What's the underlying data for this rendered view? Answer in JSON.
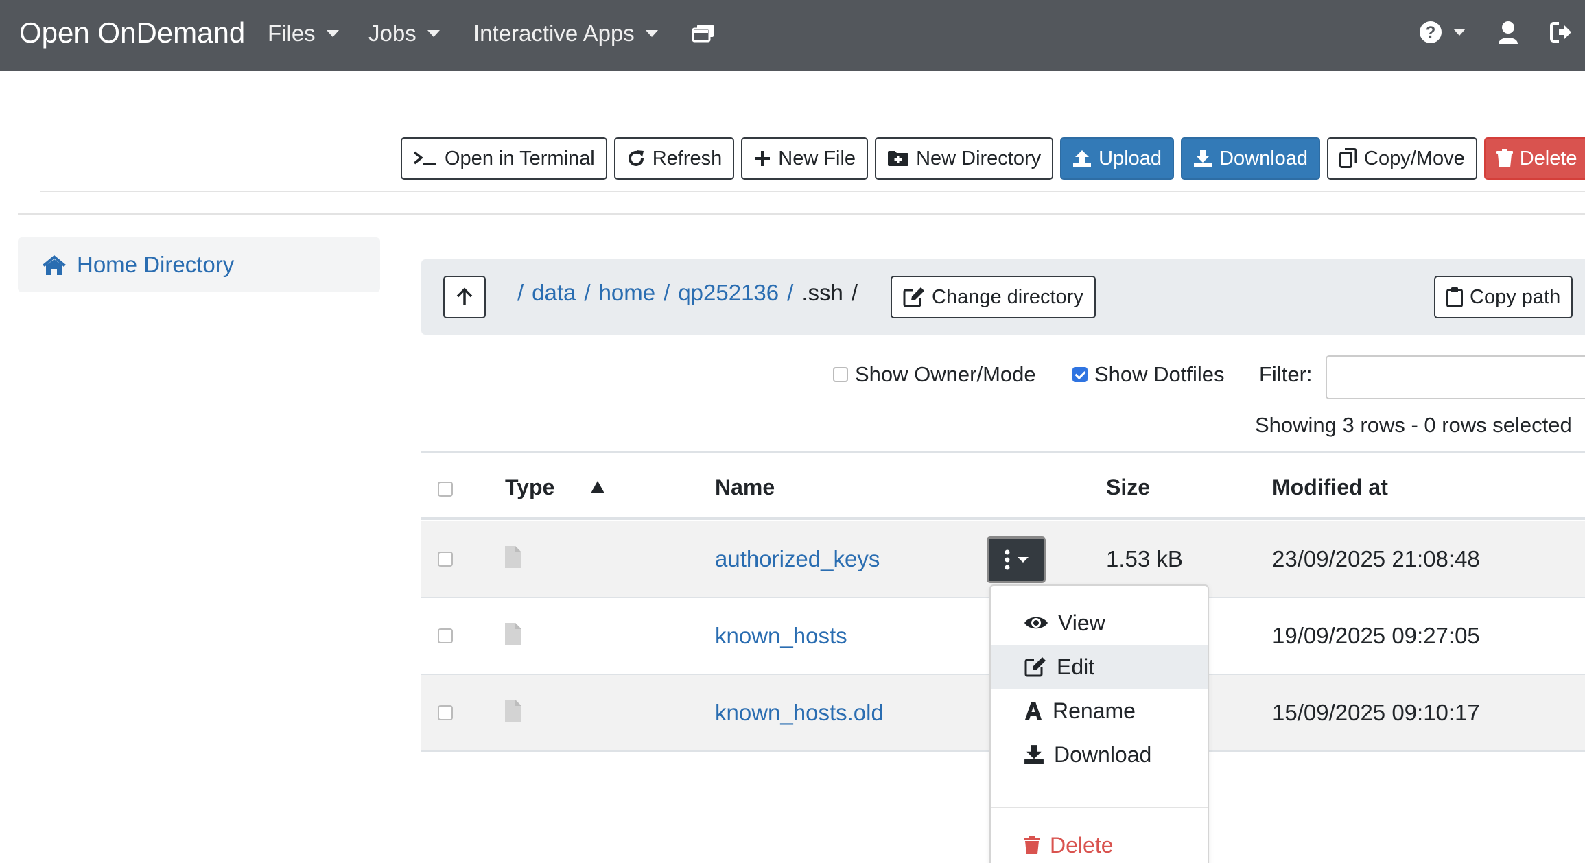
{
  "navbar": {
    "brand": "Open OnDemand",
    "menus": [
      "Files",
      "Jobs",
      "Interactive Apps"
    ],
    "bg_color": "#53575c"
  },
  "toolbar": {
    "terminal": "Open in Terminal",
    "refresh": "Refresh",
    "new_file": "New File",
    "new_directory": "New Directory",
    "upload": "Upload",
    "download": "Download",
    "copy_move": "Copy/Move",
    "delete": "Delete"
  },
  "colors": {
    "primary": "#337ab7",
    "danger": "#d9534f",
    "link": "#2a6db1"
  },
  "sidebar": {
    "home": "Home Directory"
  },
  "path": {
    "segments": [
      "data",
      "home",
      "qp252136"
    ],
    "current": ".ssh",
    "change_directory": "Change directory",
    "copy_path": "Copy path"
  },
  "options": {
    "show_owner": "Show Owner/Mode",
    "show_owner_checked": false,
    "show_dotfiles": "Show Dotfiles",
    "show_dotfiles_checked": true,
    "filter_label": "Filter:",
    "filter_value": "",
    "showing": "Showing 3 rows - 0 rows selected"
  },
  "table": {
    "headers": {
      "type": "Type",
      "name": "Name",
      "size": "Size",
      "modified": "Modified at"
    },
    "rows": [
      {
        "name": "authorized_keys",
        "size": "1.53 kB",
        "modified": "23/09/2025 21:08:48"
      },
      {
        "name": "known_hosts",
        "size": "",
        "modified": "19/09/2025 09:27:05"
      },
      {
        "name": "known_hosts.old",
        "size": "",
        "modified": "15/09/2025 09:10:17"
      }
    ]
  },
  "row_menu": {
    "view": "View",
    "edit": "Edit",
    "rename": "Rename",
    "download": "Download",
    "delete": "Delete"
  }
}
